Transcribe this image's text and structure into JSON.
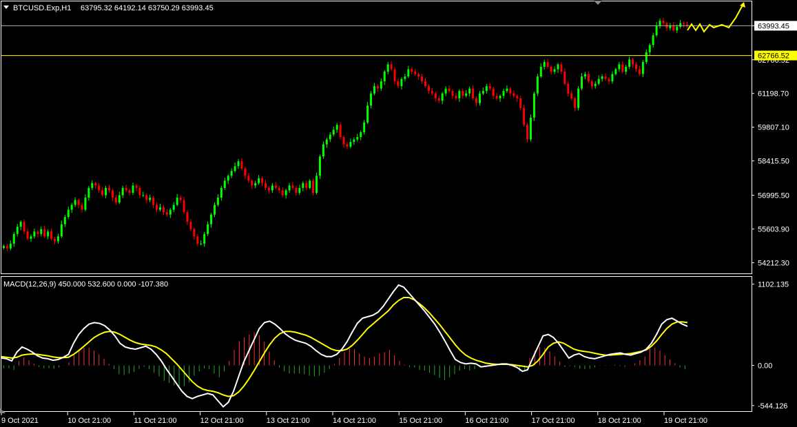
{
  "header": {
    "symbol": "BTCUSD.Exp,H1",
    "ohlc": "63795.32 64192.14 63750.29 63993.45"
  },
  "macd_header": "MACD(12,26,9) 450.000 532.600 0.000 -107.380",
  "colors": {
    "background": "#000000",
    "bull_candle": "#00ff00",
    "bear_candle": "#ff0000",
    "price_line": "#b0b0b0",
    "level_line": "#ffff00",
    "macd_line": "#ffffff",
    "signal_line": "#ffff00",
    "hist_pos": "#ff3333",
    "hist_neg": "#22aa22",
    "frame": "#ffffff"
  },
  "chart_data": [
    {
      "type": "candlestick",
      "title": "BTCUSD.Exp,H1",
      "y_ticks": [
        "63993.45",
        "62766.52",
        "61198.70",
        "59807.10",
        "58415.50",
        "56995.50",
        "55603.90",
        "54212.30"
      ],
      "y_tick_values": [
        63993.45,
        62590,
        61198.7,
        59807.1,
        58415.5,
        56995.5,
        55603.9,
        54212.3
      ],
      "ylim": [
        53800,
        65000
      ],
      "current_price": 63993.45,
      "level_price": 62766.52,
      "x_ticks": [
        "9 Oct 2021",
        "10 Oct 21:00",
        "11 Oct 21:00",
        "12 Oct 21:00",
        "13 Oct 21:00",
        "14 Oct 21:00",
        "15 Oct 21:00",
        "16 Oct 21:00",
        "17 Oct 21:00",
        "18 Oct 21:00",
        "19 Oct 21:00"
      ],
      "bars_per_day": 24,
      "close_series": [
        54900,
        54800,
        55000,
        55400,
        55700,
        55900,
        55500,
        55200,
        55300,
        55500,
        55400,
        55600,
        55300,
        55500,
        55200,
        55100,
        55300,
        55800,
        56100,
        56400,
        56600,
        56800,
        56600,
        56400,
        56900,
        57300,
        57500,
        57400,
        57200,
        57000,
        57300,
        57200,
        56900,
        56700,
        57000,
        57300,
        57200,
        57100,
        57400,
        57300,
        57000,
        57000,
        56800,
        56900,
        56600,
        56400,
        56500,
        56300,
        56200,
        56400,
        56600,
        56900,
        56800,
        56300,
        55900,
        55600,
        55300,
        55000,
        55000,
        55400,
        55800,
        56200,
        56600,
        56900,
        57300,
        57600,
        57800,
        58000,
        58200,
        58400,
        58100,
        57800,
        57600,
        57400,
        57500,
        57700,
        57500,
        57300,
        57200,
        57400,
        57300,
        57200,
        57000,
        57200,
        57400,
        57300,
        57100,
        57300,
        57500,
        57300,
        57600,
        57100,
        57800,
        58600,
        59100,
        59300,
        59500,
        59700,
        59900,
        59400,
        59100,
        59000,
        59200,
        59300,
        59400,
        59600,
        60000,
        60700,
        61200,
        61500,
        61400,
        61700,
        62100,
        62400,
        62200,
        61700,
        61500,
        61800,
        61900,
        62200,
        62100,
        62000,
        61900,
        61700,
        61500,
        61300,
        61200,
        61000,
        60900,
        61200,
        61400,
        61300,
        61100,
        61000,
        61300,
        61100,
        61200,
        61400,
        61000,
        60800,
        61200,
        61300,
        61500,
        61400,
        61100,
        61000,
        61100,
        61300,
        61400,
        61200,
        61100,
        61000,
        60600,
        59900,
        59300,
        60200,
        61200,
        61900,
        62300,
        62500,
        62300,
        62100,
        62200,
        62400,
        62100,
        61600,
        61200,
        61000,
        60600,
        61400,
        61900,
        62000,
        61700,
        61500,
        61600,
        61800,
        61900,
        61800,
        61700,
        62000,
        62200,
        62400,
        62100,
        62300,
        62600,
        62400,
        62200,
        62000,
        62500,
        62900,
        63200,
        63600,
        64000,
        64200,
        64100,
        63900,
        64000,
        63800,
        63950,
        64100,
        64050,
        63993
      ]
    },
    {
      "type": "line",
      "title": "MACD(12,26,9) 450.000 532.600 0.000 -107.380",
      "y_ticks": [
        "1102.135",
        "0.00",
        "-544.126"
      ],
      "y_tick_values": [
        1102.135,
        0,
        -544.126
      ],
      "ylim": [
        -620,
        1200
      ],
      "series": [
        {
          "name": "MACD",
          "values": [
            100,
            90,
            60,
            180,
            250,
            220,
            180,
            130,
            100,
            90,
            70,
            80,
            110,
            150,
            300,
            420,
            500,
            560,
            580,
            570,
            540,
            480,
            400,
            300,
            250,
            230,
            220,
            240,
            260,
            220,
            150,
            60,
            -50,
            -150,
            -250,
            -350,
            -420,
            -450,
            -420,
            -400,
            -380,
            -400,
            -480,
            -560,
            -500,
            -350,
            -150,
            50,
            200,
            350,
            500,
            580,
            600,
            560,
            500,
            430,
            380,
            340,
            320,
            300,
            260,
            200,
            150,
            120,
            120,
            150,
            220,
            320,
            450,
            570,
            640,
            660,
            680,
            720,
            800,
            900,
            1000,
            1090,
            1060,
            980,
            900,
            820,
            740,
            650,
            560,
            450,
            330,
            200,
            80,
            40,
            20,
            30,
            20,
            -20,
            -10,
            0,
            10,
            20,
            20,
            0,
            -30,
            -80,
            -60,
            100,
            250,
            400,
            420,
            380,
            300,
            200,
            100,
            140,
            160,
            120,
            100,
            90,
            110,
            130,
            150,
            160,
            170,
            150,
            140,
            160,
            180,
            220,
            300,
            420,
            560,
            620,
            640,
            600,
            560,
            530
          ]
        },
        {
          "name": "Signal",
          "values": [
            120,
            110,
            100,
            110,
            140,
            150,
            155,
            150,
            140,
            130,
            115,
            105,
            105,
            110,
            150,
            200,
            260,
            320,
            380,
            420,
            450,
            460,
            450,
            420,
            380,
            340,
            310,
            290,
            280,
            270,
            250,
            210,
            160,
            90,
            20,
            -60,
            -140,
            -220,
            -280,
            -320,
            -340,
            -350,
            -370,
            -400,
            -420,
            -410,
            -360,
            -280,
            -180,
            -70,
            50,
            170,
            280,
            370,
            430,
            460,
            460,
            450,
            430,
            410,
            380,
            340,
            300,
            260,
            220,
            200,
            200,
            220,
            270,
            340,
            420,
            500,
            560,
            620,
            680,
            740,
            820,
            880,
            920,
            920,
            890,
            840,
            780,
            710,
            630,
            550,
            460,
            370,
            280,
            200,
            140,
            100,
            70,
            50,
            30,
            20,
            15,
            15,
            15,
            10,
            0,
            -10,
            -20,
            0,
            60,
            150,
            250,
            300,
            320,
            300,
            260,
            220,
            200,
            190,
            180,
            165,
            150,
            140,
            140,
            145,
            150,
            155,
            160,
            175,
            190,
            210,
            260,
            330,
            420,
            500,
            560,
            590,
            590,
            580
          ]
        }
      ],
      "histogram": [
        -40,
        -40,
        -60,
        60,
        110,
        70,
        25,
        -20,
        -40,
        -40,
        -45,
        -25,
        5,
        40,
        150,
        220,
        240,
        240,
        200,
        150,
        90,
        20,
        -50,
        -120,
        -130,
        -110,
        -90,
        -50,
        -20,
        -50,
        -100,
        -150,
        -210,
        -240,
        -270,
        -290,
        -280,
        -230,
        -140,
        -80,
        -40,
        -50,
        -110,
        -160,
        -80,
        60,
        210,
        330,
        380,
        420,
        450,
        410,
        320,
        190,
        70,
        -30,
        -80,
        -110,
        -110,
        -110,
        -120,
        -140,
        -150,
        -140,
        -100,
        -50,
        20,
        100,
        180,
        230,
        220,
        160,
        120,
        100,
        120,
        160,
        180,
        210,
        140,
        60,
        10,
        -20,
        -30,
        -60,
        -70,
        -100,
        -130,
        -170,
        -200,
        -160,
        -120,
        -70,
        -50,
        -70,
        -50,
        -30,
        -15,
        -5,
        5,
        10,
        0,
        -10,
        -20,
        -80,
        -60,
        100,
        200,
        250,
        240,
        190,
        120,
        50,
        -20,
        -10,
        -20,
        -45,
        -50,
        -45,
        -25,
        -5,
        5,
        5,
        10,
        -10,
        -20,
        5,
        30,
        70,
        120,
        230,
        240,
        200,
        140,
        80,
        30,
        -30,
        -50
      ]
    }
  ]
}
